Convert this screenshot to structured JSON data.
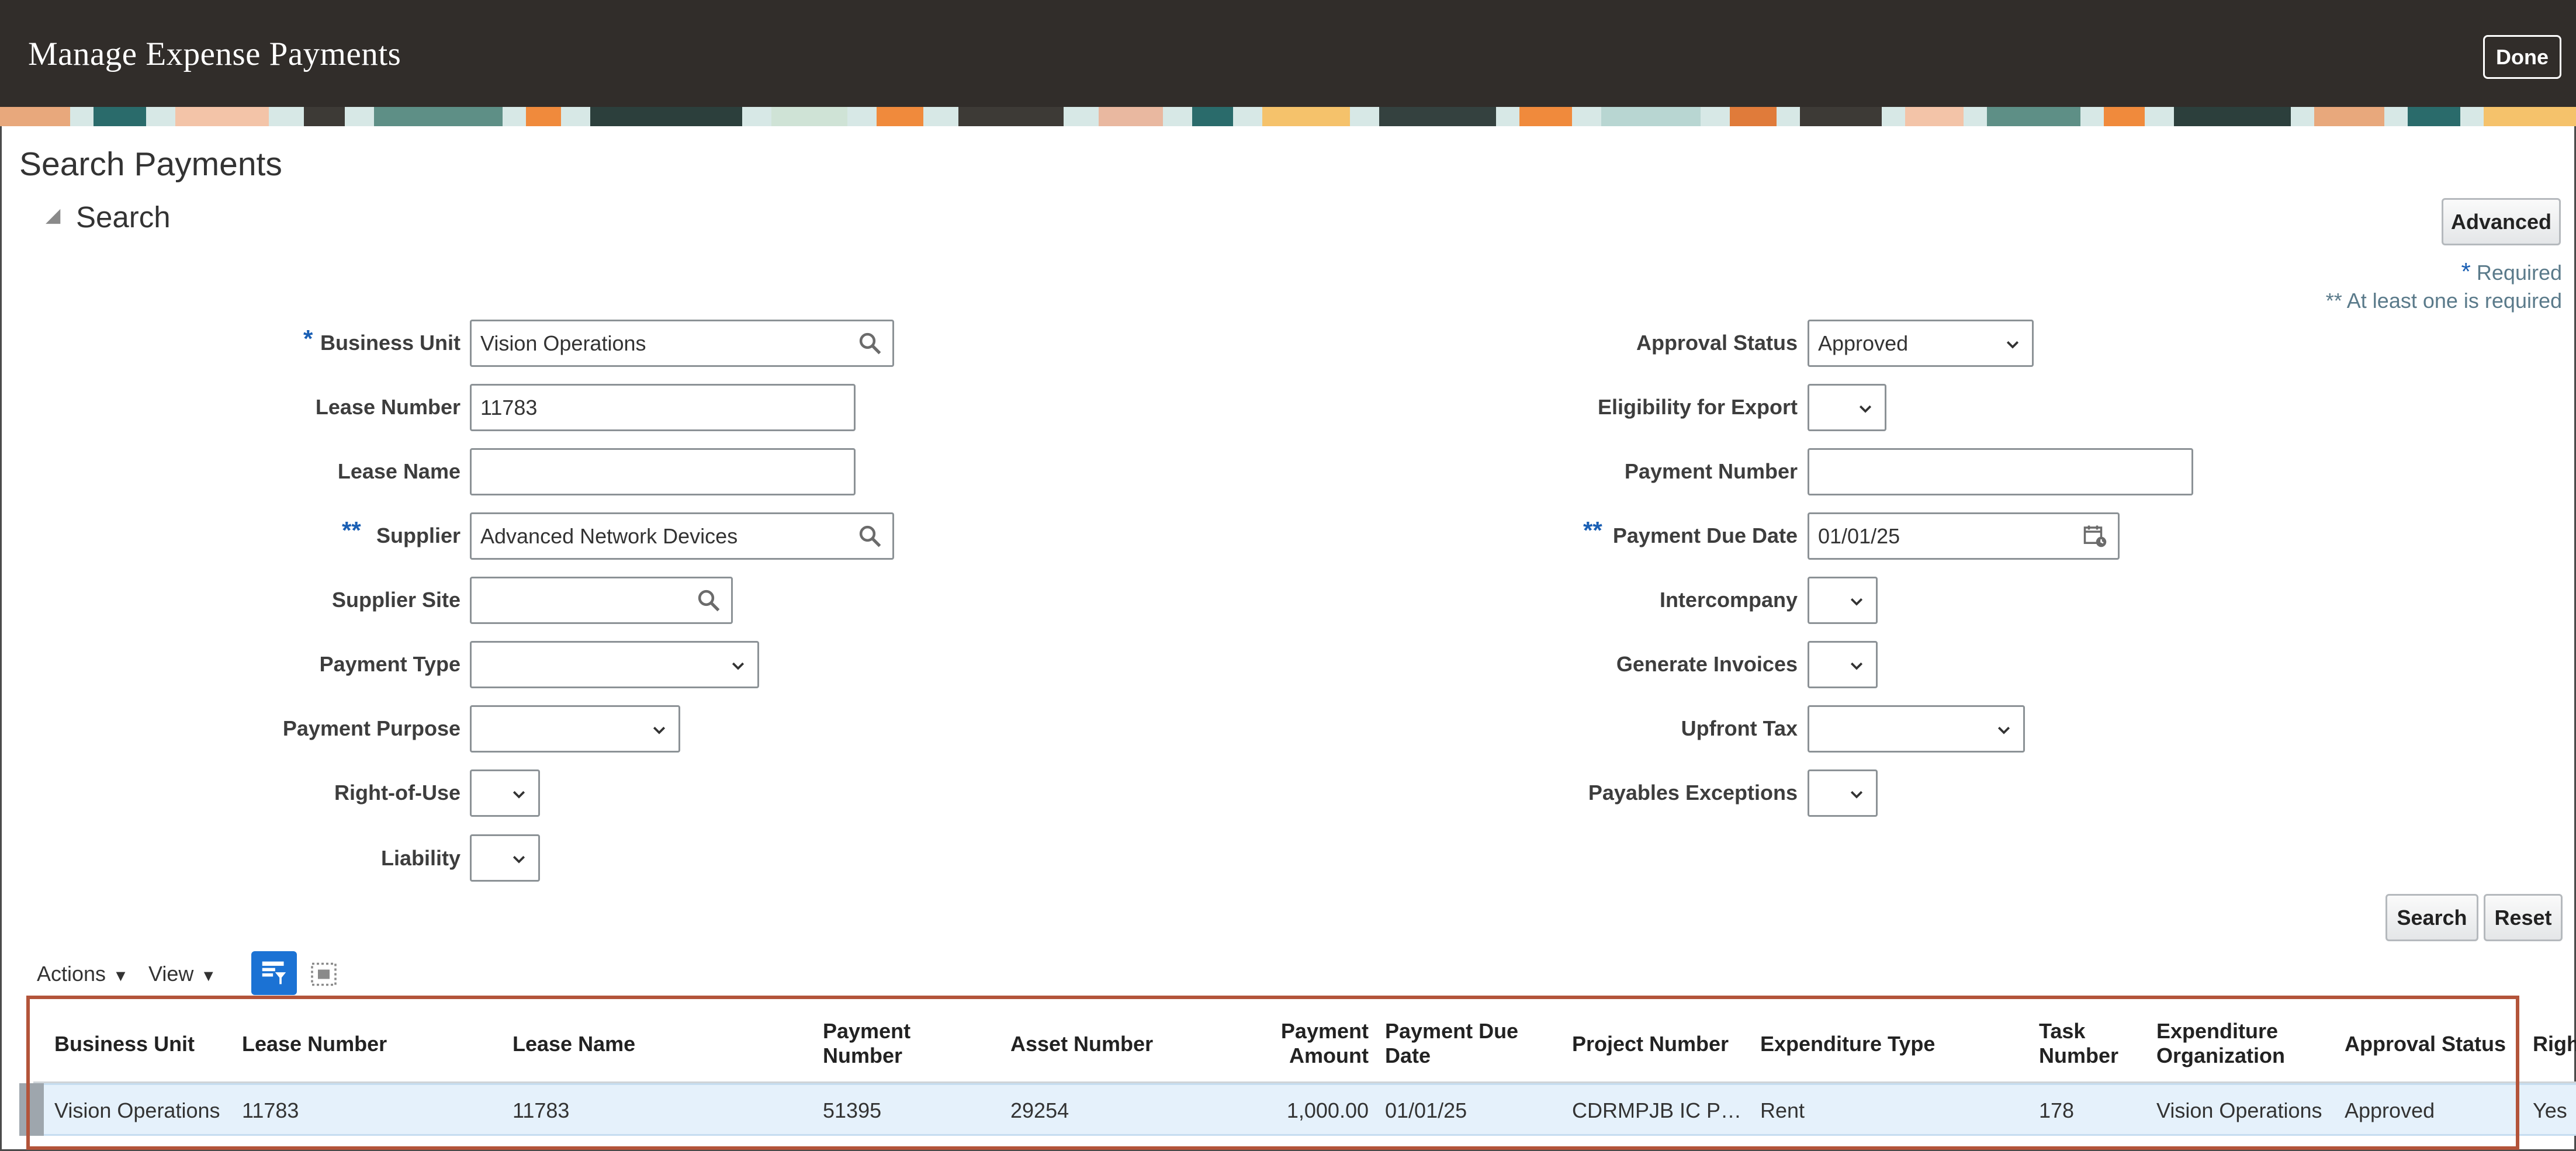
{
  "header": {
    "title": "Manage Expense Payments",
    "done_label": "Done"
  },
  "search": {
    "page_title": "Search Payments",
    "section_label": "Search",
    "toggle_glyph": "◢",
    "advanced_label": "Advanced",
    "required_star": "*",
    "required_label": "Required",
    "at_least_one_label": "** At least one is required",
    "single_star": "*",
    "double_star": "**",
    "fields": {
      "business_unit": {
        "label": "Business Unit",
        "value": "Vision Operations"
      },
      "lease_number": {
        "label": "Lease Number",
        "value": "11783"
      },
      "lease_name": {
        "label": "Lease Name",
        "value": ""
      },
      "supplier": {
        "label": "Supplier",
        "value": "Advanced Network Devices"
      },
      "supplier_site": {
        "label": "Supplier Site",
        "value": ""
      },
      "payment_type": {
        "label": "Payment Type",
        "value": ""
      },
      "payment_purpose": {
        "label": "Payment Purpose",
        "value": ""
      },
      "right_of_use": {
        "label": "Right-of-Use",
        "value": ""
      },
      "liability": {
        "label": "Liability",
        "value": ""
      },
      "approval_status": {
        "label": "Approval Status",
        "value": "Approved"
      },
      "eligibility_for_export": {
        "label": "Eligibility for Export",
        "value": ""
      },
      "payment_number": {
        "label": "Payment Number",
        "value": ""
      },
      "payment_due_date": {
        "label": "Payment Due Date",
        "value": "01/01/25"
      },
      "intercompany": {
        "label": "Intercompany",
        "value": ""
      },
      "generate_invoices": {
        "label": "Generate Invoices",
        "value": ""
      },
      "upfront_tax": {
        "label": "Upfront Tax",
        "value": ""
      },
      "payables_exceptions": {
        "label": "Payables Exceptions",
        "value": ""
      }
    },
    "search_label": "Search",
    "reset_label": "Reset"
  },
  "toolbar": {
    "actions_label": "Actions",
    "view_label": "View",
    "caret": "▼"
  },
  "table": {
    "columns": [
      {
        "line1": "Business Unit",
        "line2": ""
      },
      {
        "line1": "Lease Number",
        "line2": ""
      },
      {
        "line1": "Lease Name",
        "line2": ""
      },
      {
        "line1": "Payment",
        "line2": "Number"
      },
      {
        "line1": "Asset Number",
        "line2": ""
      },
      {
        "line1": "Payment",
        "line2": "Amount"
      },
      {
        "line1": "Payment Due",
        "line2": "Date"
      },
      {
        "line1": "Project Number",
        "line2": ""
      },
      {
        "line1": "Expenditure Type",
        "line2": ""
      },
      {
        "line1": "Task",
        "line2": "Number"
      },
      {
        "line1": "Expenditure",
        "line2": "Organization"
      },
      {
        "line1": "Approval Status",
        "line2": ""
      },
      {
        "line1": "Righ",
        "line2": ""
      }
    ],
    "rows": [
      [
        "Vision Operations",
        "11783",
        "11783",
        "51395",
        "29254",
        "1,000.00",
        "01/01/25",
        "CDRMPJB IC P…",
        "Rent",
        "178",
        "Vision Operations",
        "Approved",
        "Yes"
      ]
    ]
  },
  "colors": {
    "header_bg": "#312d2a",
    "accent_blue": "#1b72d4",
    "highlight_border": "#b3543a",
    "selected_row": "#e5f1fb"
  }
}
